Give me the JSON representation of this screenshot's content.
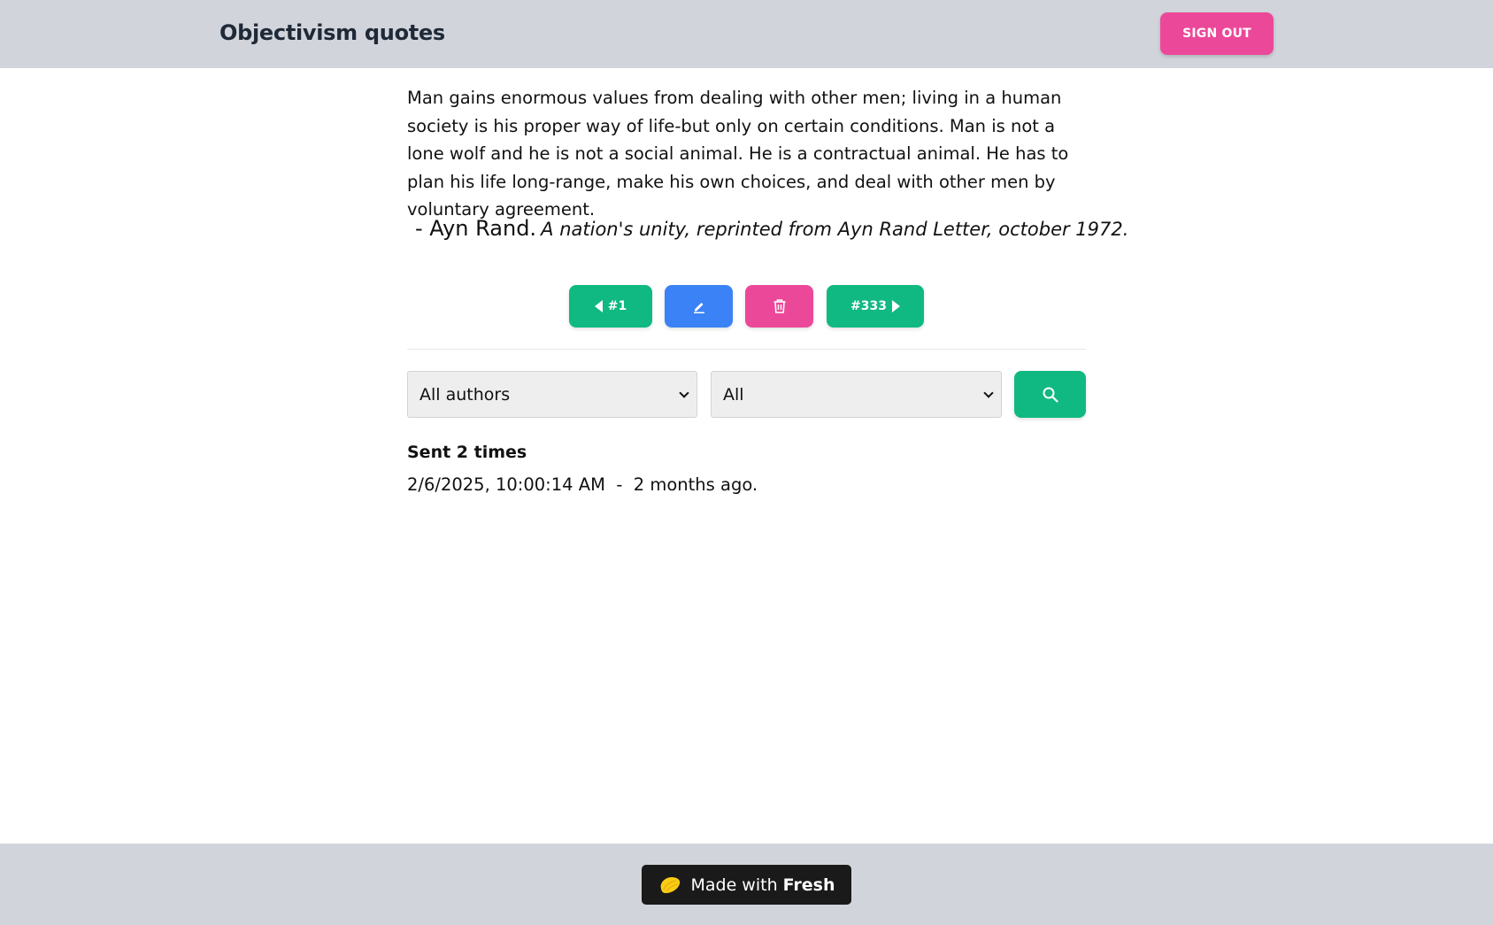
{
  "header": {
    "title": "Objectivism quotes",
    "sign_out_label": "SIGN OUT"
  },
  "quote": {
    "text": "Man gains enormous values from dealing with other men; living in a human society is his proper way of life-but only on certain conditions. Man is not a lone wolf and he is not a social animal. He is a contractual animal. He has to plan his life long-range, make his own choices, and deal with other men by voluntary agreement.",
    "author": "- Ayn Rand.",
    "source": "A nation's unity, reprinted from Ayn Rand Letter, october 1972."
  },
  "actions": {
    "prev_label": "#1",
    "next_label": "#333"
  },
  "filters": {
    "author_selected": "All authors",
    "category_selected": "All"
  },
  "stats": {
    "sent_label": "Sent 2 times",
    "last_sent": "2/6/2025, 10:00:14 AM  -  2 months ago."
  },
  "footer": {
    "made_with": "Made with",
    "brand": "Fresh"
  },
  "colors": {
    "primary_green": "#10b981",
    "edit_blue": "#3b82f6",
    "danger_pink": "#ec4899",
    "bar_gray": "#d1d5db"
  }
}
